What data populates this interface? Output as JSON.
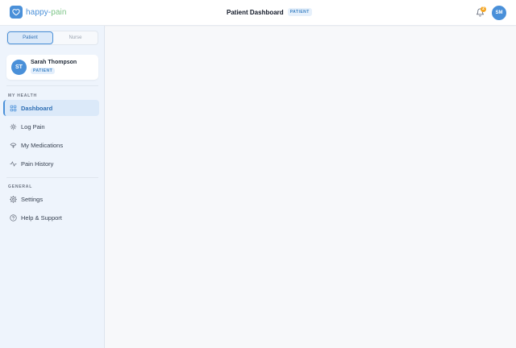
{
  "app": {
    "logo_part1": "happy-",
    "logo_part2": "pain",
    "brand_color": "#4a90d9",
    "accent_color": "#7cc487"
  },
  "header": {
    "page_title": "Patient Dashboard",
    "role_badge": "PATIENT",
    "notification_count": "2",
    "user_initials": "SM"
  },
  "role_toggle": {
    "options": [
      "Patient",
      "Nurse"
    ],
    "selected": "Patient"
  },
  "profile": {
    "initials": "ST",
    "name": "Sarah Thompson",
    "role": "PATIENT"
  },
  "sidebar": {
    "sections": [
      {
        "label": "MY HEALTH",
        "items": [
          {
            "label": "Dashboard",
            "icon": "grid-icon",
            "active": true
          },
          {
            "label": "Log Pain",
            "icon": "target-icon",
            "active": false
          },
          {
            "label": "My Medications",
            "icon": "pill-icon",
            "active": false
          },
          {
            "label": "Pain History",
            "icon": "activity-icon",
            "active": false
          }
        ]
      },
      {
        "label": "GENERAL",
        "items": [
          {
            "label": "Settings",
            "icon": "gear-icon",
            "active": false
          },
          {
            "label": "Help & Support",
            "icon": "help-circle-icon",
            "active": false
          }
        ]
      }
    ]
  }
}
